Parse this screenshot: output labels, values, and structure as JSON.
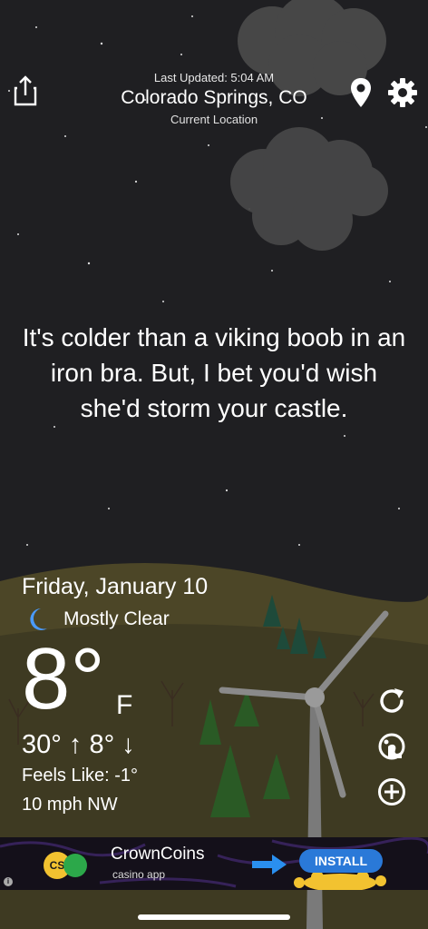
{
  "header": {
    "last_updated": "Last Updated: 5:04 AM",
    "city": "Colorado Springs, CO",
    "current_location": "Current Location"
  },
  "joke": "It's colder than a viking boob in an iron bra. But, I bet you'd wish she'd storm your castle.",
  "weather": {
    "date": "Friday, January 10",
    "condition": "Mostly Clear",
    "temperature": "8°",
    "unit": "F",
    "hi_lo": "30° ↑  8° ↓",
    "feels_like": "Feels Like: -1°",
    "wind": "10 mph NW"
  },
  "ad": {
    "brand": "CrownCoins",
    "subtitle": "casino app",
    "logo_text": "CS",
    "install_label": "INSTALL",
    "info": "i"
  },
  "icons": {
    "share": "share-icon",
    "location": "location-pin-icon",
    "settings": "gear-icon",
    "moon": "moon-icon",
    "refresh": "refresh-icon",
    "radar": "radar-icon",
    "add": "add-icon"
  },
  "colors": {
    "sky": "#1f1f22",
    "hills": "#4c4627",
    "ad_install": "#2a79d8",
    "moon": "#4a9bff"
  }
}
